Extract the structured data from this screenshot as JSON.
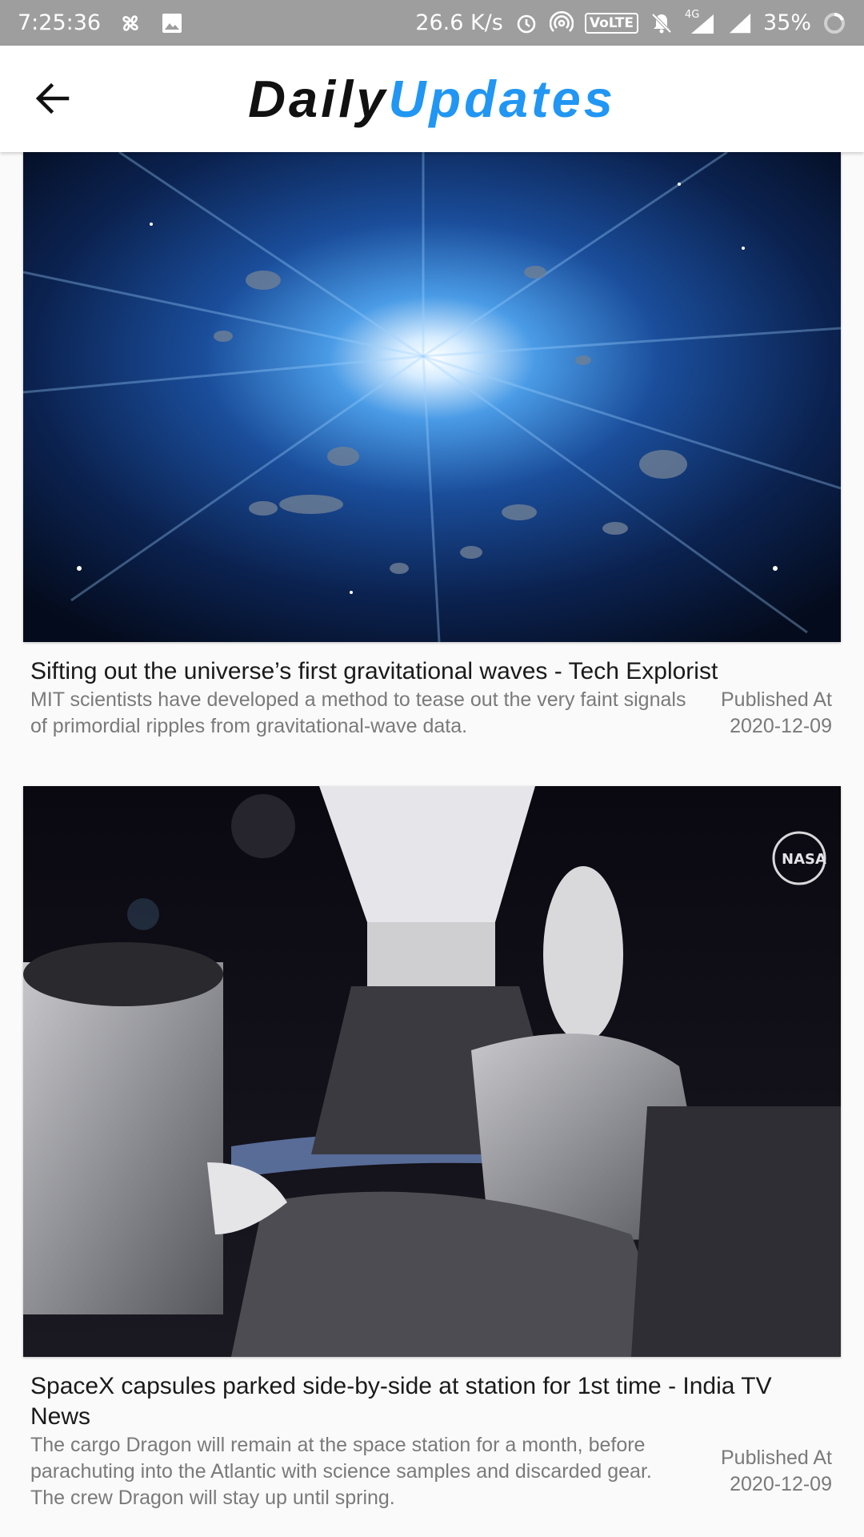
{
  "status_bar": {
    "time": "7:25:36",
    "net_speed": "26.6 K/s",
    "volte": "VoLTE",
    "network": "4G",
    "battery": "35%"
  },
  "app_bar": {
    "title_part1": "Daily",
    "title_part2": "Updates",
    "title_color1": "#111111",
    "title_color2": "#2196f3",
    "back_icon": "arrow-back-icon"
  },
  "articles": [
    {
      "title": "Sifting out the universe’s first gravitational waves - Tech Explorist",
      "description": "MIT scientists have developed a method to tease out the very faint signals of primordial ripples from gravitational-wave data.",
      "published_label": "Published At",
      "published_date": "2020-12-09",
      "image": "space-explosion-image"
    },
    {
      "title": "SpaceX capsules parked side-by-side at station for 1st time - India TV News",
      "description": "The cargo Dragon will remain at the space station for a month, before parachuting into the Atlantic with science samples and discarded gear. The crew Dragon will stay up until spring.",
      "published_label": "Published At",
      "published_date": "2020-12-09",
      "image": "spacex-dragon-image",
      "image_text": "NASA"
    }
  ]
}
